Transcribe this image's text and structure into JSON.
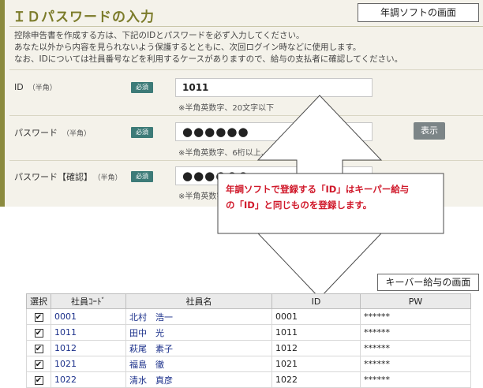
{
  "form": {
    "title": "ＩＤパスワードの入力",
    "intro": [
      "控除申告書を作成する方は、下記のIDとパスワードを必ず入力してください。",
      "あなた以外から内容を見られないよう保護するとともに、次回ログイン時などに使用します。",
      "なお、IDについては社員番号などを利用するケースがありますので、給与の支払者に確認してください。"
    ],
    "required_label": "必須",
    "id_label": "ID",
    "id_sub": "（半角）",
    "id_value": "1011",
    "id_hint": "※半角英数字、20文字以下",
    "pw_label": "パスワード",
    "pw_sub": "（半角）",
    "pw_value": "●●●●●●",
    "pw_hint": "※半角英数字、6桁以上、20桁以下",
    "pw_show_button": "表示",
    "pw_confirm_label": "パスワード【確認】",
    "pw_confirm_sub": "（半角）",
    "pw_confirm_value": "●●●●●●",
    "pw_confirm_hint": "※半角英数字、6桁以上、20桁以下"
  },
  "captions": {
    "top": "年調ソフトの画面",
    "bottom": "キーバー給与の画面"
  },
  "callout": {
    "line1_a": "年調ソフトで登録する「ID」はキーパー給与",
    "line2_a": "の「ID」と同じものを登録します。"
  },
  "table": {
    "headers": [
      "選択",
      "社員ｺｰﾄﾞ",
      "社員名",
      "ID",
      "PW"
    ],
    "rows": [
      {
        "checked": "✔",
        "code": "0001",
        "name": "北村　浩一",
        "id": "0001",
        "pw": "******"
      },
      {
        "checked": "✔",
        "code": "1011",
        "name": "田中　光",
        "id": "1011",
        "pw": "******"
      },
      {
        "checked": "✔",
        "code": "1012",
        "name": "萩尾　素子",
        "id": "1012",
        "pw": "******"
      },
      {
        "checked": "✔",
        "code": "1021",
        "name": "福島　徹",
        "id": "1021",
        "pw": "******"
      },
      {
        "checked": "✔",
        "code": "1022",
        "name": "清水　真彦",
        "id": "1022",
        "pw": "******"
      }
    ]
  },
  "colors": {
    "accent_olive": "#7b7b2a",
    "required_badge": "#3d7b78",
    "callout_red": "#d0182a",
    "table_link_blue": "#1a2f8a"
  }
}
